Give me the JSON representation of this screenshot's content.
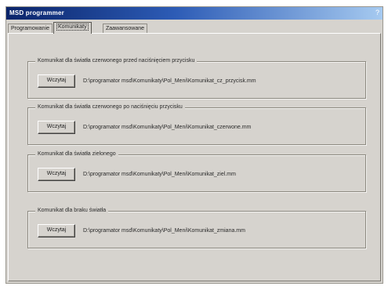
{
  "window": {
    "title": "MSD programmer",
    "control_glyph": "?"
  },
  "tabs": [
    {
      "label": "Programowanie"
    },
    {
      "label": "Komunikaty"
    },
    {
      "label": "Zaawansowane"
    }
  ],
  "groups": [
    {
      "label": "Komunikat dla światła czerwonego przed naciśnięciem przycisku",
      "button": "Wczytaj",
      "path": "D:\\programator msd\\Komunikaty\\Pol_Meni\\Komunikat_cz_przycisk.mm"
    },
    {
      "label": "Komunikat dla światła czerwonego po naciśnięciu przycisku",
      "button": "Wczytaj",
      "path": "D:\\programator msd\\Komunikaty\\Pol_Meni\\Komunikat_czerwone.mm"
    },
    {
      "label": "Komunikat dla światła zielonego",
      "button": "Wczytaj",
      "path": "D:\\programator msd\\Komunikaty\\Pol_Meni\\Komunikat_ziel.mm"
    },
    {
      "label": "Komunikat dla braku światła",
      "button": "Wczytaj",
      "path": "D:\\programator msd\\Komunikaty\\Pol_Meni\\Komunikat_zmiana.mm"
    }
  ]
}
